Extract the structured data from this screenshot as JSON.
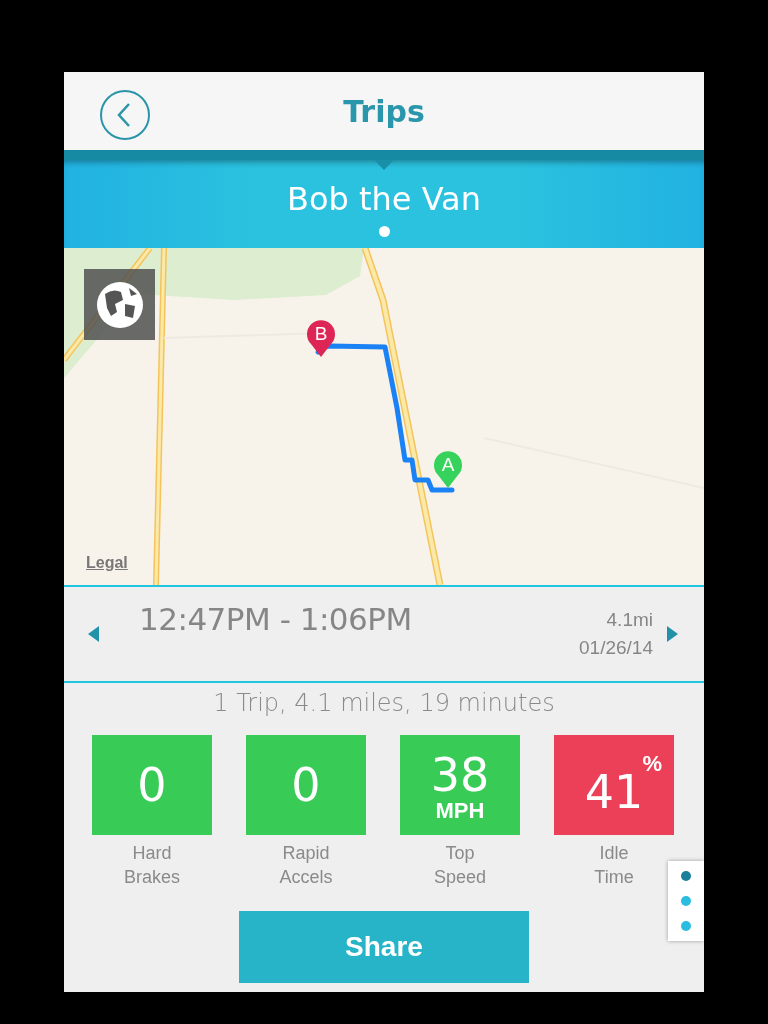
{
  "header": {
    "title": "Trips"
  },
  "vehicle": {
    "name": "Bob the Van",
    "pages": [
      {
        "selected": true
      }
    ]
  },
  "map": {
    "kind": "picture",
    "markers": [
      {
        "label": "B",
        "color": "#dd2556"
      },
      {
        "label": "A",
        "color": "#36d35c"
      }
    ],
    "legal_link": "Legal"
  },
  "trip": {
    "time_range": "12:47PM - 1:06PM",
    "distance": "4.1mi",
    "date": "01/26/14"
  },
  "summary": "1 Trip, 4.1 miles, 19 minutes",
  "stats": [
    {
      "kind": "plain",
      "value": "0",
      "label": "Hard Brakes",
      "color": "#38cc57"
    },
    {
      "kind": "plain",
      "value": "0",
      "label": "Rapid Accels",
      "color": "#38cc57"
    },
    {
      "kind": "unit_below",
      "value": "38",
      "unit": "MPH",
      "label": "Top Speed",
      "color": "#38cc57"
    },
    {
      "kind": "unit_super",
      "value": "41",
      "unit": "%",
      "label": "Idle Time",
      "color": "#ec4059"
    }
  ],
  "share_button": "Share",
  "page_dots": [
    {
      "selected": true
    },
    {
      "selected": false
    },
    {
      "selected": false
    }
  ]
}
